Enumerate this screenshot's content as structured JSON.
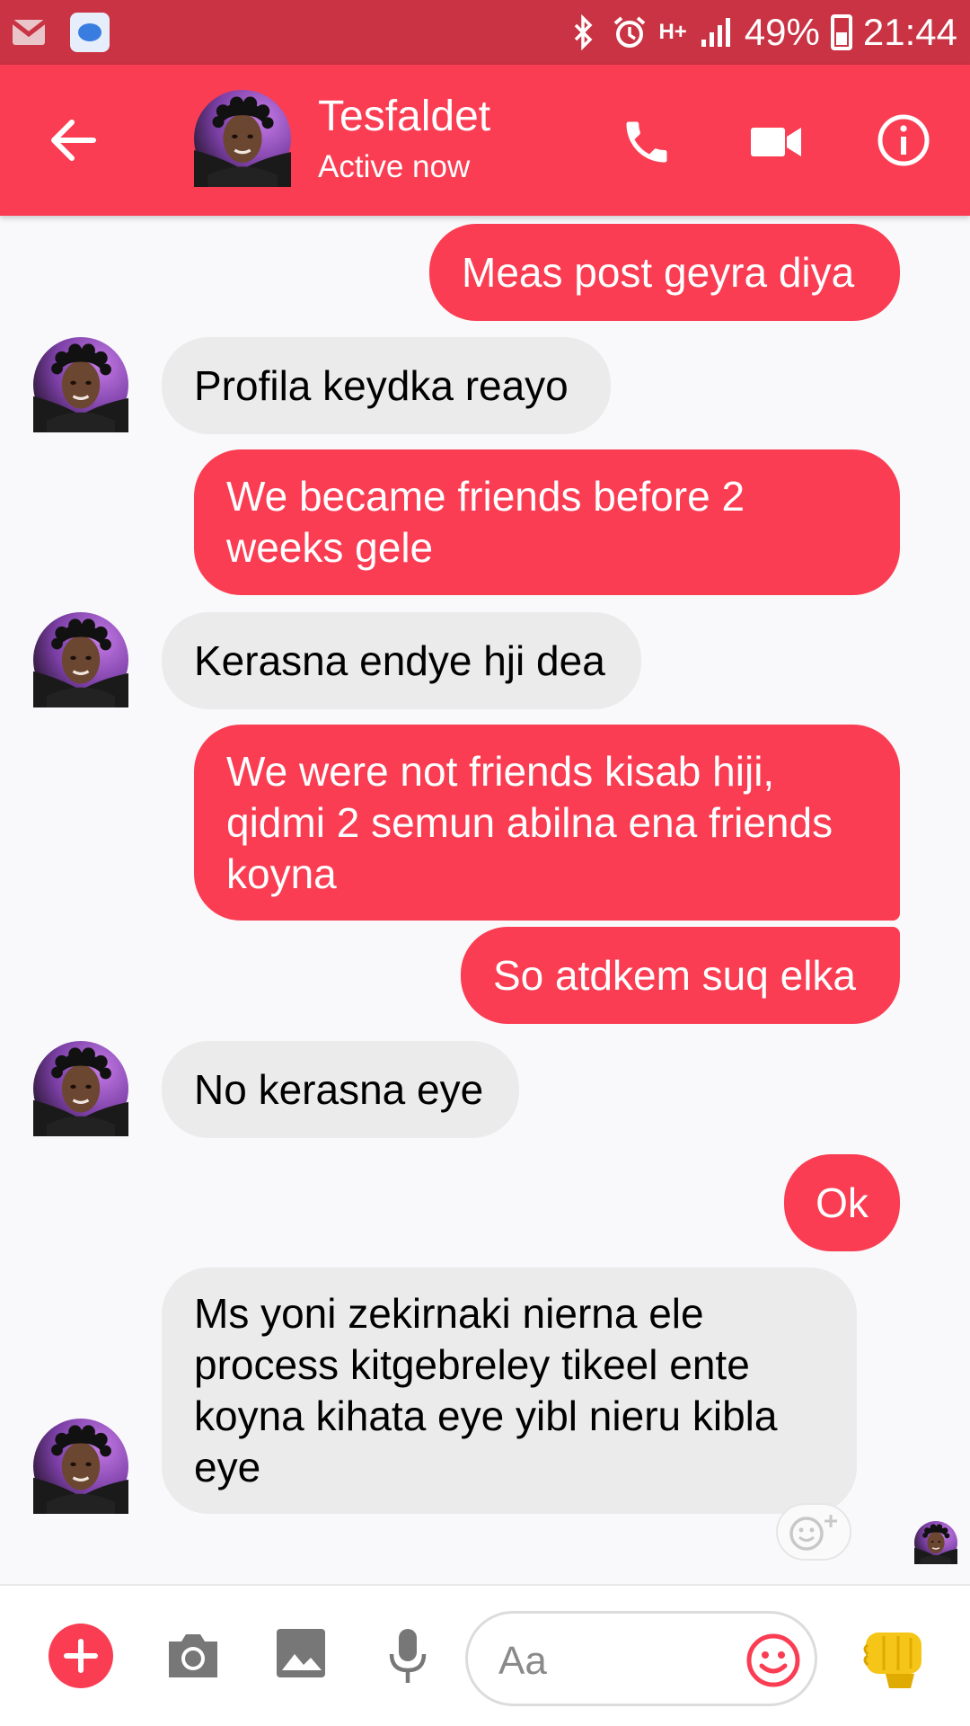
{
  "status_bar": {
    "network": "H+",
    "battery": "49%",
    "time": "21:44"
  },
  "header": {
    "contact_name": "Tesfaldet",
    "contact_status": "Active now"
  },
  "messages": [
    {
      "sender": "me",
      "text": "Meas post geyra diya"
    },
    {
      "sender": "contact",
      "text": "Profila keydka reayo"
    },
    {
      "sender": "me",
      "text": "We became friends before 2 weeks gele"
    },
    {
      "sender": "contact",
      "text": "Kerasna endye hji dea"
    },
    {
      "sender": "me",
      "text": "We were not friends kisab hiji, qidmi 2 semun abilna ena friends koyna"
    },
    {
      "sender": "me",
      "text": "So atdkem suq elka"
    },
    {
      "sender": "contact",
      "text": "No kerasna eye"
    },
    {
      "sender": "me",
      "text": "Ok"
    },
    {
      "sender": "contact",
      "text": "Ms yoni zekirnaki nierna ele process kitgebreley tikeel ente koyna kihata eye yibl nieru kibla eye"
    }
  ],
  "composer": {
    "placeholder": "Aa"
  },
  "colors": {
    "accent": "#fa3d53",
    "status_bar": "#c93343",
    "incoming_bubble": "#ebebeb",
    "background": "#f9f9fb"
  },
  "icons": [
    "gmail-icon",
    "messages-app-icon",
    "bluetooth-icon",
    "alarm-icon",
    "signal-icon",
    "battery-icon",
    "back-arrow-icon",
    "phone-icon",
    "video-camera-icon",
    "info-icon",
    "add-reaction-icon",
    "plus-icon",
    "camera-icon",
    "gallery-icon",
    "microphone-icon",
    "emoji-icon",
    "thumbs-up-icon"
  ]
}
